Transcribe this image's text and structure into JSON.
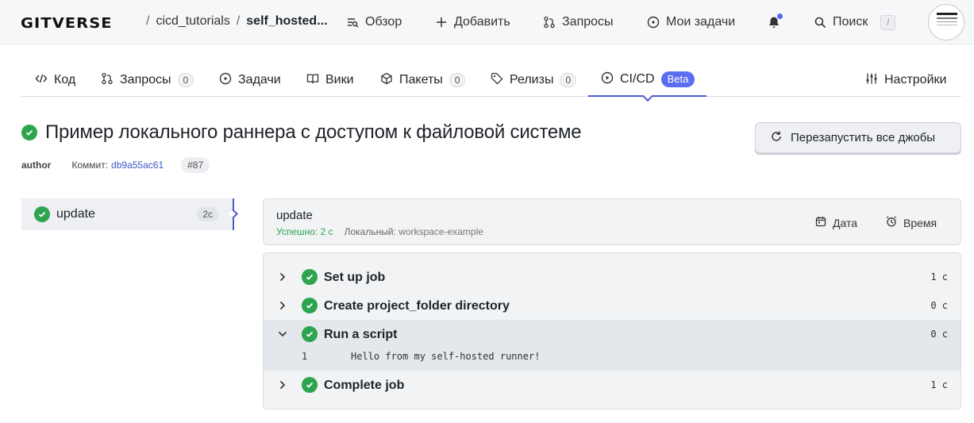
{
  "topbar": {
    "logo": "GITVERSE",
    "breadcrumb": [
      "cicd_tutorials",
      "self_hosted..."
    ],
    "nav": {
      "overview": "Обзор",
      "add": "Добавить",
      "requests": "Запросы",
      "my_tasks": "Мои задачи",
      "search": "Поиск",
      "search_shortcut": "/"
    }
  },
  "tabs": [
    {
      "label": "Код"
    },
    {
      "label": "Запросы",
      "count": "0"
    },
    {
      "label": "Задачи"
    },
    {
      "label": "Вики"
    },
    {
      "label": "Пакеты",
      "count": "0"
    },
    {
      "label": "Релизы",
      "count": "0"
    },
    {
      "label": "CI/CD",
      "badge": "Beta",
      "active": true
    },
    {
      "label": "Настройки"
    }
  ],
  "run": {
    "title": "Пример локального раннера с доступом к файловой системе",
    "author": "author",
    "commit_label": "Коммит:",
    "commit_hash": "db9a55ac61",
    "run_number": "#87",
    "restart_label": "Перезапустить все джобы"
  },
  "job_list": [
    {
      "name": "update",
      "duration": "2с"
    }
  ],
  "job": {
    "name": "update",
    "status": "Успешно: 2 с",
    "runner_label": "Локальный:",
    "runner_value": "workspace-example",
    "date_label": "Дата",
    "time_label": "Время"
  },
  "steps": [
    {
      "label": "Set up job",
      "time": "1 с"
    },
    {
      "label": "Create project_folder directory",
      "time": "0 с"
    },
    {
      "label": "Run a script",
      "time": "0 с",
      "expanded": true
    },
    {
      "label": "Complete job",
      "time": "1 с"
    }
  ],
  "log": [
    {
      "line": "1",
      "text": "Hello from my self-hosted runner!"
    }
  ],
  "colors": {
    "accent": "#4d5bcf",
    "success": "#2da44e",
    "beta": "#5b6df0"
  }
}
